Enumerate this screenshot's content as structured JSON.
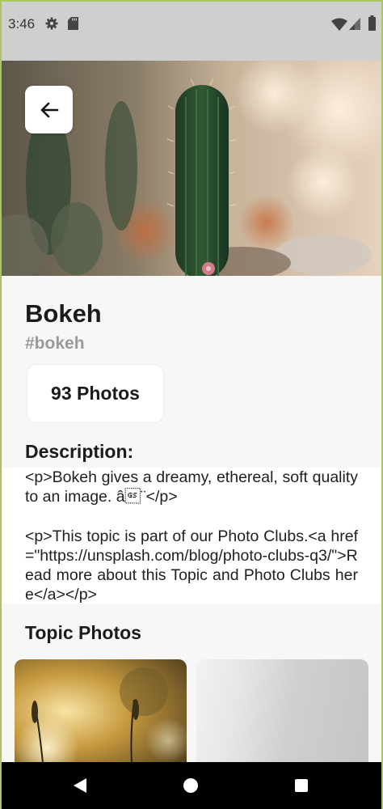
{
  "status_bar": {
    "time": "3:46",
    "icons": [
      "gear-icon",
      "sd-card-icon",
      "wifi-icon",
      "signal-icon",
      "battery-icon"
    ]
  },
  "hero": {
    "back_icon": "arrow-left-icon"
  },
  "topic": {
    "title": "Bokeh",
    "slug": "#bokeh",
    "photo_count_label": "93 Photos"
  },
  "description": {
    "heading": "Description:",
    "body": "<p>Bokeh gives a dreamy, ethereal, soft quality to an image. â\u001d¨</p>\n\n<p>This topic is part of our Photo Clubs.<a href=\"https://unsplash.com/blog/photo-clubs-q3/\">Read more about this Topic and Photo Clubs here</a></p>"
  },
  "topic_photos": {
    "heading": "Topic Photos"
  },
  "nav_bar": {
    "icons": [
      "nav-back-icon",
      "nav-home-icon",
      "nav-recents-icon"
    ]
  },
  "colors": {
    "background": "#f7f7f7",
    "status_bar": "#cfcfcf",
    "text_primary": "#1b1b1b",
    "text_secondary": "#9a9a9a",
    "card": "#ffffff"
  }
}
